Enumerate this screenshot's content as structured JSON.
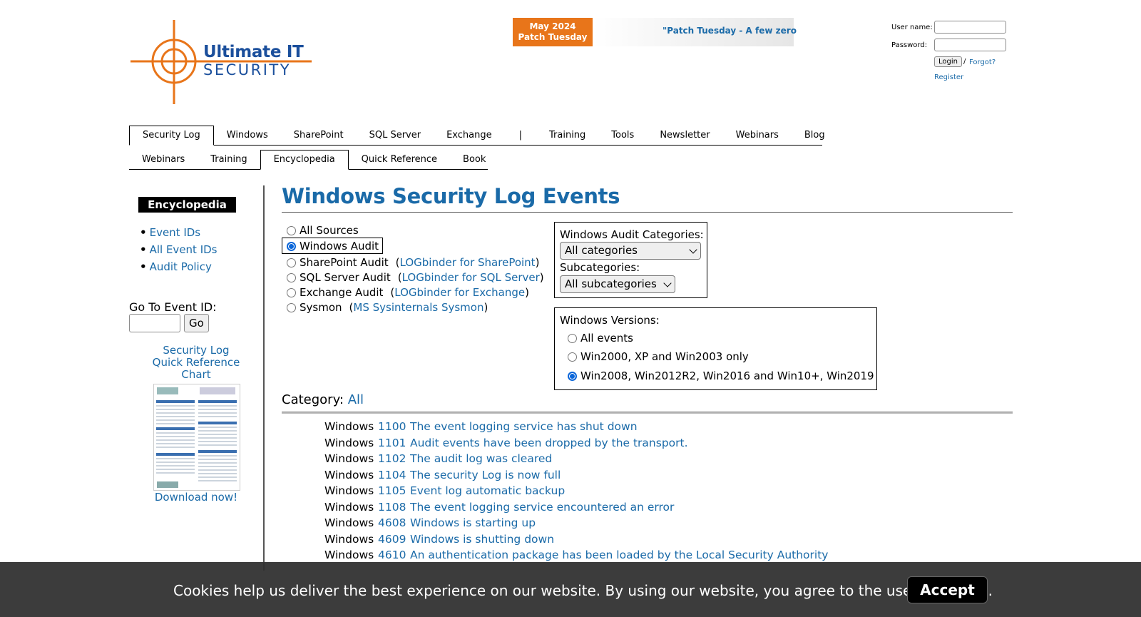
{
  "header": {
    "logo_line1": "Ultimate IT",
    "logo_line2": "SECURITY",
    "banner_badge_line1": "May 2024",
    "banner_badge_line2": "Patch Tuesday",
    "banner_quote": "\"Patch Tuesday - A few zero",
    "login": {
      "username_label": "User name:",
      "password_label": "Password:",
      "login_button": "Login",
      "separator": "/",
      "forgot": "Forgot?",
      "register": "Register"
    }
  },
  "nav": {
    "primary": [
      "Security Log",
      "Windows",
      "SharePoint",
      "SQL Server",
      "Exchange",
      "|",
      "Training",
      "Tools",
      "Newsletter",
      "Webinars",
      "Blog"
    ],
    "secondary": [
      "Webinars",
      "Training",
      "Encyclopedia",
      "Quick Reference",
      "Book"
    ]
  },
  "sidebar": {
    "heading": "Encyclopedia",
    "links": [
      "Event IDs",
      "All Event IDs",
      "Audit Policy"
    ],
    "goto_label": "Go To Event ID:",
    "goto_button": "Go",
    "qr_title_1": "Security Log",
    "qr_title_2": "Quick Reference",
    "qr_title_3": "Chart",
    "qr_download": "Download now!"
  },
  "main": {
    "title": "Windows Security Log Events",
    "sources": [
      {
        "label": "All Sources",
        "paren": "",
        "link": "",
        "close": "",
        "checked": false
      },
      {
        "label": "Windows Audit",
        "paren": "",
        "link": "",
        "close": "",
        "checked": true
      },
      {
        "label": "SharePoint Audit",
        "paren": "(",
        "link": "LOGbinder for SharePoint",
        "close": ")",
        "checked": false
      },
      {
        "label": "SQL Server Audit",
        "paren": "(",
        "link": "LOGbinder for SQL Server",
        "close": ")",
        "checked": false
      },
      {
        "label": "Exchange Audit",
        "paren": "(",
        "link": "LOGbinder for Exchange",
        "close": ")",
        "checked": false
      },
      {
        "label": "Sysmon",
        "paren": "(",
        "link": "MS Sysinternals Sysmon",
        "close": ")",
        "checked": false
      }
    ],
    "categories_label": "Windows Audit Categories:",
    "categories_value": "All categories",
    "subcategories_label": "Subcategories:",
    "subcategories_value": "All subcategories",
    "versions_label": "Windows Versions:",
    "versions": [
      {
        "label": "All events",
        "checked": false
      },
      {
        "label": "Win2000, XP and Win2003 only",
        "checked": false
      },
      {
        "label": "Win2008, Win2012R2, Win2016 and Win10+, Win2019",
        "checked": true
      }
    ],
    "category_prefix": "Category:",
    "category_value": "All",
    "events": [
      {
        "source": "Windows",
        "id": "1100",
        "desc": "The event logging service has shut down"
      },
      {
        "source": "Windows",
        "id": "1101",
        "desc": "Audit events have been dropped by the transport."
      },
      {
        "source": "Windows",
        "id": "1102",
        "desc": "The audit log was cleared"
      },
      {
        "source": "Windows",
        "id": "1104",
        "desc": "The security Log is now full"
      },
      {
        "source": "Windows",
        "id": "1105",
        "desc": "Event log automatic backup"
      },
      {
        "source": "Windows",
        "id": "1108",
        "desc": "The event logging service encountered an error"
      },
      {
        "source": "Windows",
        "id": "4608",
        "desc": "Windows is starting up"
      },
      {
        "source": "Windows",
        "id": "4609",
        "desc": "Windows is shutting down"
      },
      {
        "source": "Windows",
        "id": "4610",
        "desc": "An authentication package has been loaded by the Local Security Authority"
      }
    ]
  },
  "cookie": {
    "text": "Cookies help us deliver the best experience on our website. By using our website, you agree to the use of cookies.",
    "accept": "Accept"
  },
  "colors": {
    "link": "#1a6aa8",
    "logo_orange": "#e8751a",
    "logo_blue": "#1b4f9c",
    "radio_checked": "#0a66d9"
  }
}
